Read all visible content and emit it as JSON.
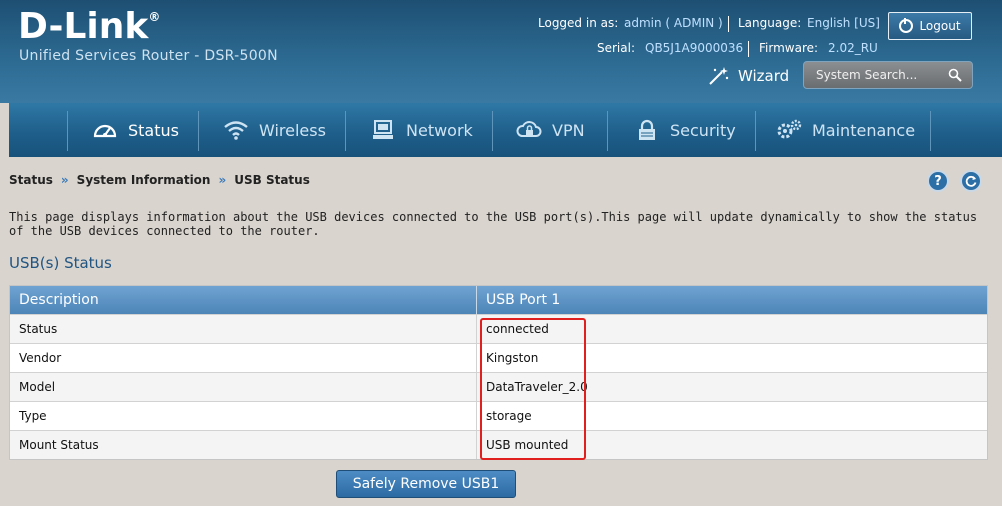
{
  "header": {
    "brand": "D-Link",
    "brand_mark": "®",
    "product": "Unified Services Router - DSR-500N",
    "logged_in_label": "Logged in as:",
    "logged_in_value": "admin ( ADMIN )",
    "language_label": "Language:",
    "language_value": "English [US]",
    "serial_label": "Serial:",
    "serial_value": "QB5J1A9000036",
    "firmware_label": "Firmware:",
    "firmware_value": "2.02_RU",
    "logout_label": "Logout",
    "wizard_label": "Wizard",
    "search_placeholder": "System Search..."
  },
  "nav": {
    "items": [
      {
        "label": "Status",
        "icon": "gauge-icon",
        "active": true
      },
      {
        "label": "Wireless",
        "icon": "wifi-icon"
      },
      {
        "label": "Network",
        "icon": "computer-icon"
      },
      {
        "label": "VPN",
        "icon": "cloud-lock-icon"
      },
      {
        "label": "Security",
        "icon": "lock-icon"
      },
      {
        "label": "Maintenance",
        "icon": "gears-icon"
      }
    ]
  },
  "breadcrumb": [
    "Status",
    "System Information",
    "USB Status"
  ],
  "breadcrumb_separator": "»",
  "help_icon_label": "?",
  "description": "This page displays information about the USB devices connected to the USB port(s).This page will update dynamically to show the status of the USB devices connected to the router.",
  "section_title": "USB(s) Status",
  "table": {
    "headers": [
      "Description",
      "USB Port 1"
    ],
    "rows": [
      {
        "label": "Status",
        "value": "connected"
      },
      {
        "label": "Vendor",
        "value": "Kingston"
      },
      {
        "label": "Model",
        "value": "DataTraveler_2.0"
      },
      {
        "label": "Type",
        "value": "storage"
      },
      {
        "label": "Mount Status",
        "value": "USB mounted"
      }
    ]
  },
  "remove_button_label": "Safely Remove USB1",
  "colors": {
    "header_bg": "#1e4f73",
    "nav_bg": "#1f5f8b",
    "table_header": "#5a8fc2",
    "highlight_border": "#e0201e",
    "page_bg": "#d9d4ce"
  }
}
